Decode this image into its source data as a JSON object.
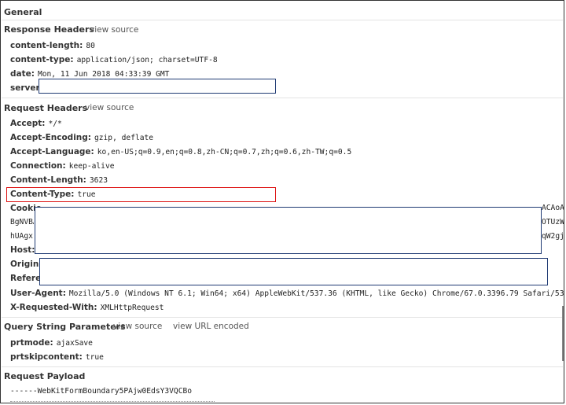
{
  "general": {
    "title": "General"
  },
  "response_headers": {
    "title": "Response Headers",
    "view_source": "view source",
    "items": [
      {
        "key": "content-length:",
        "value": "80"
      },
      {
        "key": "content-type:",
        "value": "application/json; charset=UTF-8"
      },
      {
        "key": "date:",
        "value": "Mon, 11 Jun 2018 04:33:39 GMT"
      },
      {
        "key": "server:",
        "value": ""
      }
    ]
  },
  "request_headers": {
    "title": "Request Headers",
    "view_source": "view source",
    "items": [
      {
        "key": "Accept:",
        "value": "*/*"
      },
      {
        "key": "Accept-Encoding:",
        "value": "gzip, deflate"
      },
      {
        "key": "Accept-Language:",
        "value": "ko,en-US;q=0.9,en;q=0.8,zh-CN;q=0.7,zh;q=0.6,zh-TW;q=0.5"
      },
      {
        "key": "Connection:",
        "value": "keep-alive"
      },
      {
        "key": "Content-Length:",
        "value": "3623"
      },
      {
        "key": "Content-Type:",
        "value": "true"
      },
      {
        "key": "Cookie",
        "value": ""
      },
      {
        "key": "Host:",
        "value": ""
      },
      {
        "key": "Origin:",
        "value": ""
      },
      {
        "key": "Referer:",
        "value": ""
      },
      {
        "key": "User-Agent:",
        "value": "Mozilla/5.0 (Windows NT 6.1; Win64; x64) AppleWebKit/537.36 (KHTML, like Gecko) Chrome/67.0.3396.79 Safari/537.36"
      },
      {
        "key": "X-Requested-With:",
        "value": "XMLHttpRequest"
      }
    ],
    "cookie_fragments": {
      "line2_left": "BgNVBA",
      "line3_left": "hUAgxr",
      "line1_right": "ACAoA",
      "line2_right": "OTUzW.",
      "line3_right": "qW2gj."
    }
  },
  "query_string": {
    "title": "Query String Parameters",
    "view_source": "view source",
    "view_url_encoded": "view URL encoded",
    "items": [
      {
        "key": "prtmode:",
        "value": "ajaxSave"
      },
      {
        "key": "prtskipcontent:",
        "value": "true"
      }
    ]
  },
  "request_payload": {
    "title": "Request Payload",
    "line": "------WebKitFormBoundary5PAjw0EdsY3VQCBo"
  },
  "colors": {
    "highlight": "#dd1111",
    "redact_border": "#1f3a73"
  }
}
